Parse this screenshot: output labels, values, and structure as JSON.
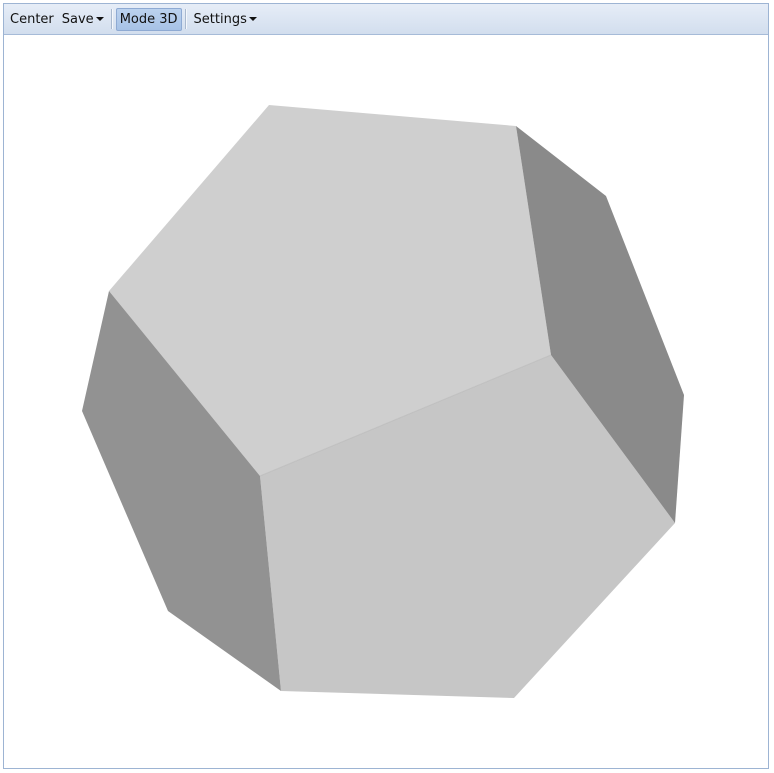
{
  "toolbar": {
    "center_label": "Center",
    "save_label": "Save",
    "mode_label": "Mode 3D",
    "settings_label": "Settings"
  },
  "scene": {
    "object": "dodecahedron",
    "colors": {
      "face_light": "#cfcfcf",
      "face_front": "#c6c6c6",
      "face_side_left": "#929292",
      "face_side_right": "#8a8a8a",
      "edge": "#b8b8b8"
    }
  }
}
